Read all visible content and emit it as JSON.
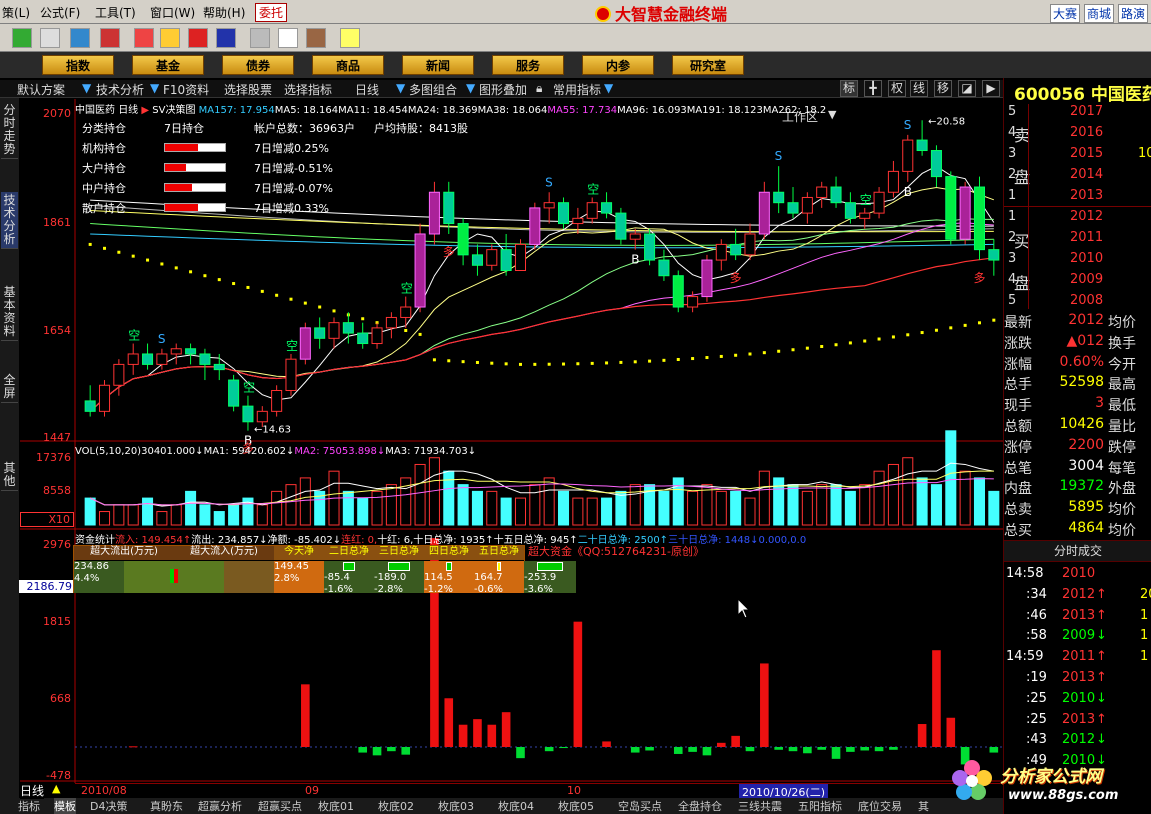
{
  "menu": {
    "items": [
      "策(L)",
      "公式(F)",
      "工具(T)",
      "窗口(W)",
      "帮助(H)"
    ],
    "delegate": "委托",
    "title": "大智慧金融终端",
    "right": [
      "大赛",
      "商城",
      "路演"
    ]
  },
  "navbar": {
    "items": [
      "指数",
      "基金",
      "债券",
      "商品",
      "新闻",
      "服务",
      "内参",
      "研究室"
    ],
    "workarea": "工作区"
  },
  "subbar": {
    "items": [
      "默认方案",
      "技术分析",
      "F10资料",
      "选择股票",
      "选择指标",
      "日线",
      "多图组合",
      "图形叠加",
      "常用指标"
    ],
    "right_icons": [
      "标",
      "╋",
      "权",
      "线",
      "移",
      "◪",
      "▶"
    ]
  },
  "side_tabs": [
    "分时走势",
    "技术分析",
    "基本资料",
    "全屏",
    "其他"
  ],
  "panel1": {
    "stock": "中国医药",
    "period": "日线",
    "indicator": "SV决策图",
    "ma": [
      {
        "label": "MA157: 17.954",
        "color": "#33ccff"
      },
      {
        "label": "MA5: 18.164",
        "color": "#ffffff"
      },
      {
        "label": "MA11: 18.454",
        "color": "#ffffff"
      },
      {
        "label": "MA24: 18.369",
        "color": "#ffffff"
      },
      {
        "label": "MA38: 18.064",
        "color": "#ffffff"
      },
      {
        "label": "MA55: 17.734",
        "color": "#ff44ff"
      },
      {
        "label": "MA96: 16.093",
        "color": "#ffffff"
      },
      {
        "label": "MA191: 18.123",
        "color": "#ffffff"
      },
      {
        "label": "MA262: 18.2",
        "color": "#ffffff"
      }
    ],
    "yaxis": [
      "2070",
      "1861",
      "1654",
      "1447"
    ],
    "annotations": {
      "low": "14.63",
      "high": "20.58",
      "kong": "空",
      "s": "S",
      "b": "B",
      "duo": "多"
    }
  },
  "holdings": {
    "header": [
      "分类持仓",
      "7日持仓",
      "帐户总数：36963户",
      "户均持股：8413股"
    ],
    "rows": [
      {
        "name": "机构持仓",
        "pct": 0.55,
        "change": "7日增减0.25%"
      },
      {
        "name": "大户持仓",
        "pct": 0.35,
        "change": "7日增减-0.51%"
      },
      {
        "name": "中户持仓",
        "pct": 0.45,
        "change": "7日增减-0.07%"
      },
      {
        "name": "散户持仓",
        "pct": 0.55,
        "change": "7日增减0.33%"
      }
    ]
  },
  "panel2": {
    "head": [
      {
        "t": "VOL(5,10,20)",
        "c": "#ffffff"
      },
      {
        "t": "30401.000↓",
        "c": "#ffffff"
      },
      {
        "t": "MA1: 59420.602↓",
        "c": "#ffffff"
      },
      {
        "t": "MA2: 75053.898↓",
        "c": "#ff44ff"
      },
      {
        "t": "MA3: 71934.703↓",
        "c": "#ffffff"
      }
    ],
    "yaxis": [
      "17376",
      "8558",
      "X10"
    ]
  },
  "panel3": {
    "head": [
      {
        "t": "资金统计",
        "c": "#ffffff"
      },
      {
        "t": "流入: 149.454↑",
        "c": "#ff3333"
      },
      {
        "t": "流出: 234.857↓",
        "c": "#ffffff"
      },
      {
        "t": "净额: -85.402↓",
        "c": "#ffffff"
      },
      {
        "t": "连红: 0,",
        "c": "#ff3333"
      },
      {
        "t": "十红: 6,",
        "c": "#ffffff"
      },
      {
        "t": "十日总净: 1935↑",
        "c": "#ffffff"
      },
      {
        "t": "十五日总净: 945↑",
        "c": "#ffffff"
      },
      {
        "t": "二十日总净: 2500↑",
        "c": "#33ccff"
      },
      {
        "t": "三十日总净: 1448↓",
        "c": "#3355ff"
      },
      {
        "t": "0.000,",
        "c": "#3355ff"
      },
      {
        "t": "0.0",
        "c": "#3355ff"
      }
    ],
    "table_headers": [
      "超大流出(万元)",
      "超大流入(万元)",
      "今天净",
      "二日总净",
      "三日总净",
      "四日总净",
      "五日总净"
    ],
    "table_values": [
      [
        "234.86",
        "4.4%"
      ],
      [
        "",
        ""
      ],
      [
        "149.45",
        "2.8%"
      ],
      [
        "-85.4",
        "-1.6%"
      ],
      [
        "-189.0",
        "-2.8%"
      ],
      [
        "114.5",
        "-1.2%"
      ],
      [
        "164.7",
        "-0.6%"
      ],
      [
        "-253.9",
        "-3.6%"
      ]
    ],
    "brand": "超大资金《QQ:512764231-原创》",
    "yaxis": [
      "2976",
      "1815",
      "668",
      "-478"
    ],
    "cursor_value": "2186.79"
  },
  "dates": {
    "items": [
      "2010/08",
      "09",
      "10"
    ],
    "highlight": "2010/10/26(二)"
  },
  "bottom_tabs": {
    "period": "日线",
    "items": [
      "指标",
      "模板",
      "D4决策",
      "真盼东",
      "超赢分析",
      "超赢买点",
      "枚底01",
      "枚底02",
      "枚底03",
      "枚底04",
      "枚底05",
      "空岛买点",
      "全盘持仓",
      "三线共震",
      "五阳指标",
      "底位交易",
      "其"
    ]
  },
  "quote": {
    "code": "600056",
    "name": "中国医药",
    "sell": [
      {
        "n": "5",
        "p": "2017"
      },
      {
        "n": "4",
        "p": "2016"
      },
      {
        "n": "3",
        "p": "2015"
      },
      {
        "n": "2",
        "p": "2014"
      },
      {
        "n": "1",
        "p": "2013"
      }
    ],
    "buy": [
      {
        "n": "1",
        "p": "2012"
      },
      {
        "n": "2",
        "p": "2011"
      },
      {
        "n": "3",
        "p": "2010"
      },
      {
        "n": "4",
        "p": "2009"
      },
      {
        "n": "5",
        "p": "2008"
      }
    ],
    "sell_label": [
      "卖",
      "盘"
    ],
    "buy_label": [
      "买",
      "盘"
    ],
    "sell_vol": [
      "",
      "",
      "10",
      "",
      ""
    ],
    "stats": [
      {
        "l": "最新",
        "v": "2012",
        "c": "#ff3333",
        "r": "均价"
      },
      {
        "l": "涨跌",
        "v": "▲012",
        "c": "#ff3333",
        "r": "换手"
      },
      {
        "l": "涨幅",
        "v": "0.60%",
        "c": "#ff3333",
        "r": "今开"
      },
      {
        "l": "总手",
        "v": "52598",
        "c": "#ffff00",
        "r": "最高"
      },
      {
        "l": "现手",
        "v": "3",
        "c": "#ff3333",
        "r": "最低"
      },
      {
        "l": "总额",
        "v": "10426",
        "c": "#ffff00",
        "r": "量比"
      },
      {
        "l": "涨停",
        "v": "2200",
        "c": "#ff3333",
        "r": "跌停"
      },
      {
        "l": "总笔",
        "v": "3004",
        "c": "#ffffff",
        "r": "每笔"
      },
      {
        "l": "内盘",
        "v": "19372",
        "c": "#00ff00",
        "r": "外盘"
      },
      {
        "l": "总卖",
        "v": "5895",
        "c": "#ffff00",
        "r": "均价"
      },
      {
        "l": "总买",
        "v": "4864",
        "c": "#ffff00",
        "r": "均价"
      }
    ],
    "ticks_title": "分时成交",
    "ticks": [
      {
        "t": "14:58",
        "p": "2010",
        "a": "",
        "c": "#ff3333",
        "e": ""
      },
      {
        "t": ":34",
        "p": "2012",
        "a": "↑",
        "c": "#ff3333",
        "e": "20"
      },
      {
        "t": ":46",
        "p": "2013",
        "a": "↑",
        "c": "#ff3333",
        "e": "1"
      },
      {
        "t": ":58",
        "p": "2009",
        "a": "↓",
        "c": "#00ff00",
        "e": "1"
      },
      {
        "t": "14:59",
        "p": "2011",
        "a": "↑",
        "c": "#ff3333",
        "e": "1"
      },
      {
        "t": ":19",
        "p": "2013",
        "a": "↑",
        "c": "#ff3333",
        "e": ""
      },
      {
        "t": ":25",
        "p": "2010",
        "a": "↓",
        "c": "#00ff00",
        "e": ""
      },
      {
        "t": ":25",
        "p": "2013",
        "a": "↑",
        "c": "#ff3333",
        "e": ""
      },
      {
        "t": ":43",
        "p": "2012",
        "a": "↓",
        "c": "#00ff00",
        "e": ""
      },
      {
        "t": ":49",
        "p": "2010",
        "a": "↓",
        "c": "#00ff00",
        "e": ""
      }
    ]
  },
  "watermark": {
    "brand": "分析家公式网",
    "url": "www.88gs.com"
  },
  "chart_data": [
    {
      "type": "candlestick",
      "title": "中国医药 日线 SV决策图",
      "ylim": [
        14.47,
        20.7
      ],
      "ohlc": [
        [
          15.2,
          15.5,
          14.9,
          15.0
        ],
        [
          15.0,
          15.6,
          14.9,
          15.5
        ],
        [
          15.5,
          16.0,
          15.3,
          15.9
        ],
        [
          15.9,
          16.3,
          15.7,
          16.1
        ],
        [
          16.1,
          16.3,
          15.8,
          15.9
        ],
        [
          15.9,
          16.2,
          15.8,
          16.1
        ],
        [
          16.1,
          16.3,
          15.9,
          16.2
        ],
        [
          16.2,
          16.3,
          15.9,
          16.1
        ],
        [
          16.1,
          16.2,
          15.6,
          15.9
        ],
        [
          15.9,
          16.1,
          15.6,
          15.8
        ],
        [
          15.6,
          15.7,
          15.0,
          15.1
        ],
        [
          15.1,
          15.3,
          14.63,
          14.8
        ],
        [
          14.8,
          15.1,
          14.7,
          15.0
        ],
        [
          15.0,
          15.5,
          14.9,
          15.4
        ],
        [
          15.4,
          16.1,
          15.3,
          16.0
        ],
        [
          16.0,
          16.7,
          15.9,
          16.6
        ],
        [
          16.6,
          16.8,
          16.2,
          16.4
        ],
        [
          16.4,
          16.8,
          16.2,
          16.7
        ],
        [
          16.7,
          16.9,
          16.3,
          16.5
        ],
        [
          16.5,
          16.7,
          16.2,
          16.3
        ],
        [
          16.3,
          16.7,
          16.2,
          16.6
        ],
        [
          16.6,
          16.9,
          16.4,
          16.8
        ],
        [
          16.8,
          17.2,
          16.6,
          17.0
        ],
        [
          17.0,
          18.6,
          16.9,
          18.4
        ],
        [
          18.4,
          19.4,
          18.2,
          19.2
        ],
        [
          19.2,
          19.4,
          18.4,
          18.6
        ],
        [
          18.6,
          18.7,
          17.8,
          18.0
        ],
        [
          18.0,
          18.2,
          17.6,
          17.8
        ],
        [
          17.8,
          18.2,
          17.7,
          18.1
        ],
        [
          18.1,
          18.4,
          17.6,
          17.7
        ],
        [
          17.7,
          18.3,
          17.7,
          18.2
        ],
        [
          18.2,
          19.0,
          18.1,
          18.9
        ],
        [
          18.9,
          19.2,
          18.6,
          19.0
        ],
        [
          19.0,
          19.1,
          18.5,
          18.6
        ],
        [
          18.6,
          18.9,
          18.4,
          18.7
        ],
        [
          18.7,
          19.1,
          18.6,
          19.0
        ],
        [
          19.0,
          19.2,
          18.7,
          18.8
        ],
        [
          18.8,
          18.9,
          18.2,
          18.3
        ],
        [
          18.3,
          18.5,
          18.1,
          18.4
        ],
        [
          18.4,
          18.5,
          17.8,
          17.9
        ],
        [
          17.9,
          18.1,
          17.5,
          17.6
        ],
        [
          17.6,
          17.7,
          16.9,
          17.0
        ],
        [
          17.0,
          17.3,
          16.9,
          17.2
        ],
        [
          17.2,
          18.0,
          17.1,
          17.9
        ],
        [
          17.9,
          18.3,
          17.7,
          18.2
        ],
        [
          18.2,
          18.5,
          17.9,
          18.0
        ],
        [
          18.0,
          18.6,
          17.9,
          18.4
        ],
        [
          18.4,
          19.4,
          18.3,
          19.2
        ],
        [
          19.2,
          19.7,
          18.8,
          19.0
        ],
        [
          19.0,
          19.3,
          18.7,
          18.8
        ],
        [
          18.8,
          19.2,
          18.6,
          19.1
        ],
        [
          19.1,
          19.4,
          18.9,
          19.3
        ],
        [
          19.3,
          19.5,
          18.9,
          19.0
        ],
        [
          19.0,
          19.2,
          18.6,
          18.7
        ],
        [
          18.7,
          18.9,
          18.5,
          18.8
        ],
        [
          18.8,
          19.3,
          18.7,
          19.2
        ],
        [
          19.2,
          19.8,
          19.1,
          19.6
        ],
        [
          19.6,
          20.3,
          19.4,
          20.2
        ],
        [
          20.2,
          20.58,
          19.9,
          20.0
        ],
        [
          20.0,
          20.1,
          19.3,
          19.5
        ],
        [
          19.5,
          19.6,
          18.2,
          18.3
        ],
        [
          18.3,
          19.4,
          18.2,
          19.3
        ],
        [
          19.3,
          19.5,
          17.9,
          18.1
        ],
        [
          18.1,
          18.3,
          17.6,
          17.9
        ]
      ],
      "ma_values": [
        [
          "MA157",
          17.954
        ],
        [
          "MA5",
          18.164
        ],
        [
          "MA11",
          18.454
        ],
        [
          "MA24",
          18.369
        ],
        [
          "MA38",
          18.064
        ],
        [
          "MA55",
          17.734
        ],
        [
          "MA96",
          16.093
        ],
        [
          "MA191",
          18.123
        ]
      ]
    },
    {
      "type": "bar",
      "title": "VOL(5,10,20)",
      "ylim": [
        0,
        17376
      ],
      "values": [
        4,
        2,
        3,
        3,
        4,
        2,
        3,
        5,
        3,
        2,
        3,
        4,
        3,
        5,
        6,
        7,
        5,
        8,
        5,
        4,
        5,
        6,
        7,
        9,
        10,
        8,
        6,
        5,
        5,
        4,
        4,
        6,
        7,
        5,
        4,
        4,
        4,
        5,
        6,
        6,
        5,
        7,
        5,
        6,
        5,
        5,
        4,
        8,
        7,
        6,
        5,
        6,
        6,
        5,
        6,
        8,
        9,
        10,
        7,
        6,
        14,
        8,
        7,
        5
      ]
    },
    {
      "type": "bar",
      "title": "资金统计",
      "ylim": [
        -478,
        2976
      ],
      "values": [
        0,
        0,
        0,
        10,
        0,
        0,
        0,
        0,
        0,
        0,
        0,
        0,
        0,
        0,
        0,
        900,
        0,
        0,
        0,
        -80,
        -120,
        -60,
        -110,
        0,
        3000,
        700,
        320,
        400,
        320,
        500,
        -160,
        0,
        -60,
        -15,
        1800,
        0,
        80,
        0,
        -80,
        -50,
        0,
        -100,
        -70,
        -120,
        60,
        160,
        -60,
        1200,
        -40,
        -60,
        -90,
        -40,
        -170,
        -70,
        -50,
        -60,
        -40,
        0,
        330,
        1390,
        420,
        -250,
        0,
        -80,
        -60,
        210,
        -50,
        -60
      ]
    }
  ]
}
